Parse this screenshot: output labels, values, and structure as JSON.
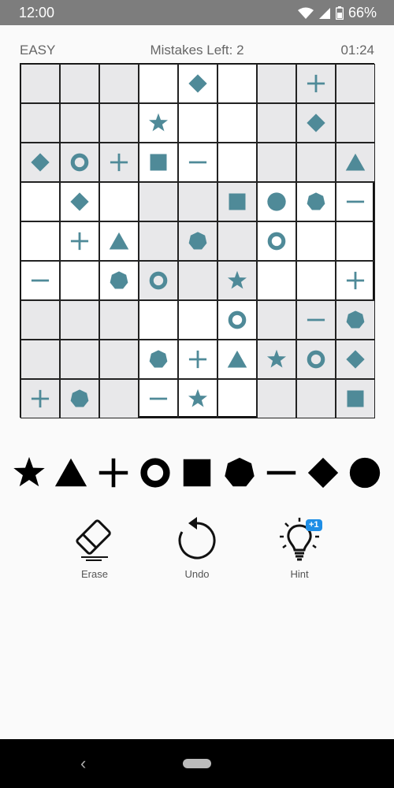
{
  "status": {
    "time": "12:00",
    "battery": "66%"
  },
  "header": {
    "difficulty": "EASY",
    "mistakes": "Mistakes Left: 2",
    "timer": "01:24"
  },
  "colors": {
    "symbol": "#4f8a98",
    "shade": "#e8e8ea",
    "palette": "#000000"
  },
  "board": {
    "shading": [
      [
        1,
        1,
        1,
        0,
        0,
        0,
        1,
        1,
        1
      ],
      [
        1,
        1,
        1,
        0,
        0,
        0,
        1,
        1,
        1
      ],
      [
        1,
        1,
        1,
        0,
        0,
        0,
        1,
        1,
        1
      ],
      [
        0,
        0,
        0,
        1,
        1,
        1,
        0,
        0,
        0
      ],
      [
        0,
        0,
        0,
        1,
        1,
        1,
        0,
        0,
        0
      ],
      [
        0,
        0,
        0,
        1,
        1,
        1,
        0,
        0,
        0
      ],
      [
        1,
        1,
        1,
        0,
        0,
        0,
        1,
        1,
        1
      ],
      [
        1,
        1,
        1,
        0,
        0,
        0,
        1,
        1,
        1
      ],
      [
        1,
        1,
        1,
        0,
        0,
        0,
        1,
        1,
        1
      ]
    ],
    "grid": [
      [
        "",
        "",
        "",
        "",
        "diamond",
        "",
        "",
        "plus",
        ""
      ],
      [
        "",
        "",
        "",
        "star",
        "",
        "",
        "",
        "diamond",
        ""
      ],
      [
        "diamond",
        "ring",
        "plus",
        "square",
        "minus",
        "",
        "",
        "",
        "triangle"
      ],
      [
        "",
        "diamond",
        "",
        "",
        "",
        "square",
        "circle",
        "heptagon",
        "minus"
      ],
      [
        "",
        "plus",
        "triangle",
        "",
        "heptagon",
        "",
        "ring",
        "",
        ""
      ],
      [
        "minus",
        "",
        "heptagon",
        "ring",
        "",
        "star",
        "",
        "",
        "plus"
      ],
      [
        "",
        "",
        "",
        "",
        "",
        "ring",
        "",
        "minus",
        "heptagon"
      ],
      [
        "",
        "",
        "",
        "heptagon",
        "plus",
        "triangle",
        "star",
        "ring",
        "diamond"
      ],
      [
        "plus",
        "heptagon",
        "",
        "minus",
        "star",
        "",
        "",
        "",
        "square"
      ]
    ]
  },
  "palette": [
    "star",
    "triangle",
    "plus",
    "ring",
    "square",
    "heptagon",
    "minus",
    "diamond",
    "circle"
  ],
  "tools": [
    {
      "id": "erase",
      "label": "Erase",
      "icon": "eraser-icon"
    },
    {
      "id": "undo",
      "label": "Undo",
      "icon": "undo-icon"
    },
    {
      "id": "hint",
      "label": "Hint",
      "icon": "lightbulb-icon",
      "badge": "+1"
    }
  ]
}
